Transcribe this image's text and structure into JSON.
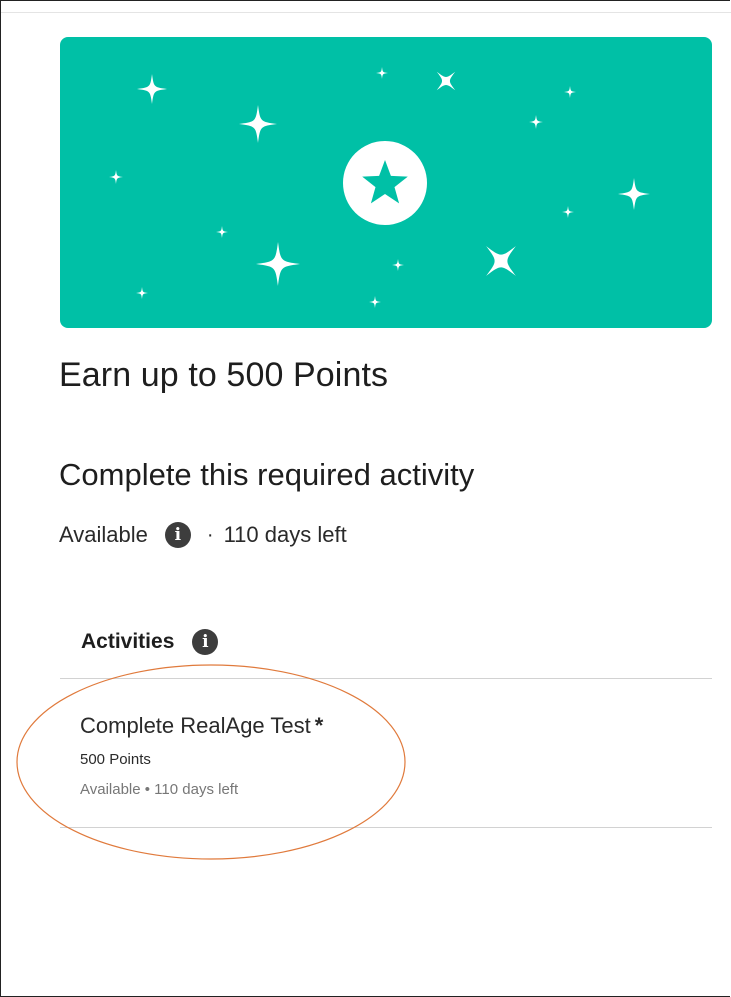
{
  "hero": {
    "background_color": "#00c0a6",
    "badge_icon": "star-badge-icon"
  },
  "title": "Earn up to 500 Points",
  "requirement": {
    "heading": "Complete this required activity",
    "status": "Available",
    "info_icon": "i",
    "separator": "·",
    "days_left": "110 days left"
  },
  "activities": {
    "header": "Activities",
    "info_icon": "i",
    "items": [
      {
        "name": "Complete RealAge Test",
        "required_marker": "*",
        "points": "500 Points",
        "status": "Available • 110 days left"
      }
    ]
  },
  "annotation": {
    "color": "#e07a3c"
  }
}
